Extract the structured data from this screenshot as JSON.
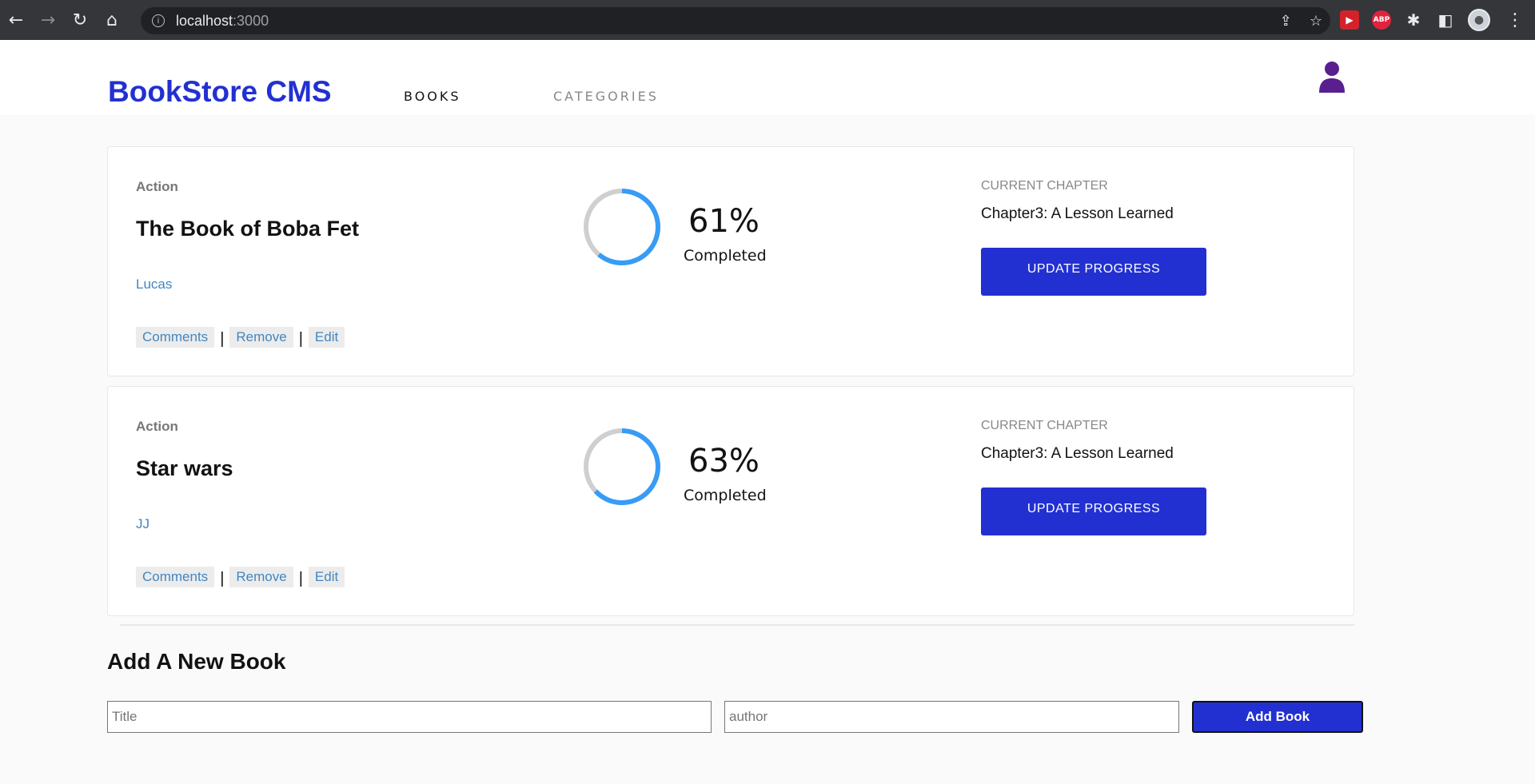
{
  "browser": {
    "url_host": "localhost",
    "url_port": ":3000"
  },
  "header": {
    "logo": "BookStore CMS",
    "nav": [
      {
        "label": "BOOKS"
      },
      {
        "label": "CATEGORIES"
      }
    ]
  },
  "books": [
    {
      "genre": "Action",
      "title": "The Book of Boba Fet",
      "author": "Lucas",
      "progress_percent": 61,
      "percent_label": "61%",
      "completed_label": "Completed",
      "chapter_label": "CURRENT CHAPTER",
      "chapter": "Chapter3: A Lesson Learned",
      "update_label": "UPDATE PROGRESS",
      "actions": [
        "Comments",
        "Remove",
        "Edit"
      ]
    },
    {
      "genre": "Action",
      "title": "Star wars",
      "author": "JJ",
      "progress_percent": 63,
      "percent_label": "63%",
      "completed_label": "Completed",
      "chapter_label": "CURRENT CHAPTER",
      "chapter": "Chapter3: A Lesson Learned",
      "update_label": "UPDATE PROGRESS",
      "actions": [
        "Comments",
        "Remove",
        "Edit"
      ]
    }
  ],
  "form": {
    "heading": "Add A New Book",
    "title_placeholder": "Title",
    "author_placeholder": "author",
    "submit_label": "Add Book"
  },
  "colors": {
    "primary": "#2230d2",
    "progress": "#379cf6",
    "progress_track": "#cfcfcf",
    "link": "#4386bf",
    "user_icon": "#5a1f8f"
  },
  "icons": [
    "back-icon",
    "forward-icon",
    "reload-icon",
    "home-icon",
    "info-icon",
    "share-icon",
    "star-icon",
    "extensions-icon",
    "sidebar-icon",
    "user-icon"
  ]
}
